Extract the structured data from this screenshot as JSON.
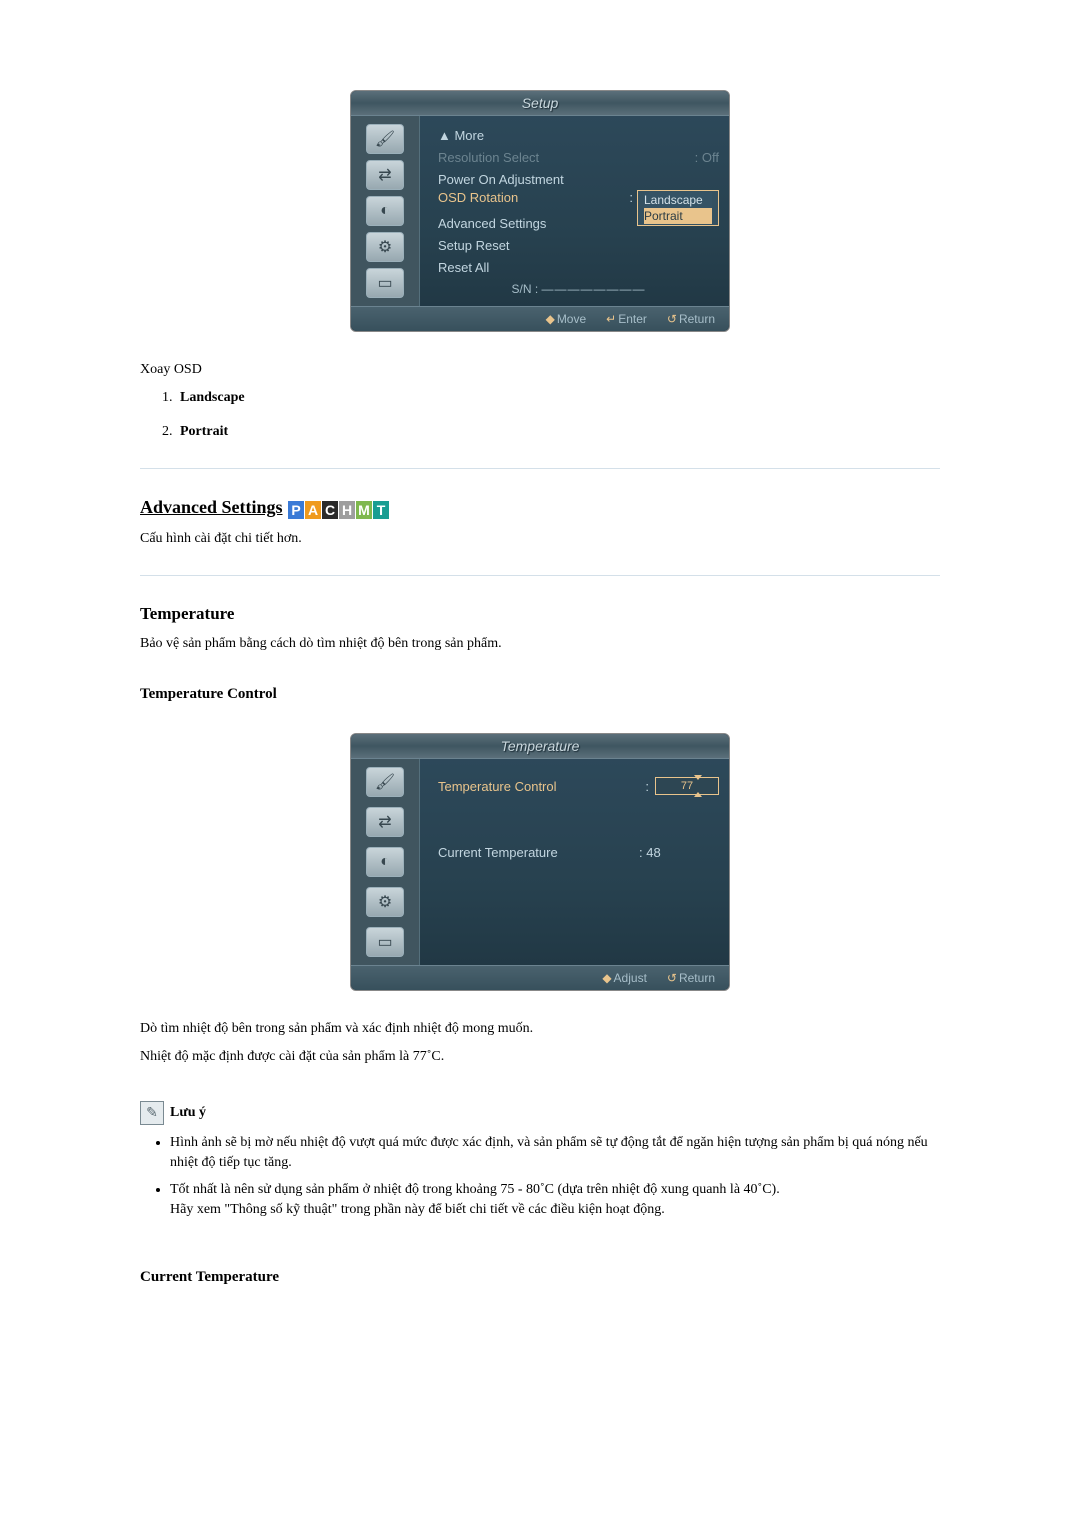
{
  "osd_setup": {
    "title": "Setup",
    "menu": {
      "more": "▲ More",
      "resolution": "Resolution Select",
      "resolution_val": ": Off",
      "power_on": "Power On Adjustment",
      "osd_rotation": "OSD Rotation",
      "osd_rotation_sep": ":",
      "dropdown_opt1": "Landscape",
      "dropdown_opt2": "Portrait",
      "advanced": "Advanced Settings",
      "setup_reset": "Setup Reset",
      "reset_all": "Reset All",
      "sn": "S/N : "
    },
    "footer": {
      "move_icon": "◆",
      "move": "Move",
      "enter_icon": "↵",
      "enter": "Enter",
      "return_icon": "↺",
      "return": "Return"
    }
  },
  "xoay_label": "Xoay OSD",
  "enum": {
    "landscape": "Landscape",
    "portrait": "Portrait"
  },
  "adv_settings": {
    "title": "Advanced Settings",
    "badges": {
      "p": "P",
      "a": "A",
      "c": "C",
      "h": "H",
      "m": "M",
      "t": "T"
    },
    "desc": "Cấu hình cài đặt chi tiết hơn."
  },
  "temperature": {
    "title": "Temperature",
    "desc": "Bảo vệ sản phẩm bằng cách dò tìm nhiệt độ bên trong sản phẩm.",
    "control_title": "Temperature Control"
  },
  "osd_temp": {
    "title": "Temperature",
    "control_label": "Temperature Control",
    "control_sep": ":",
    "control_val": "77",
    "current_label": "Current Temperature",
    "current_val": ": 48",
    "footer": {
      "adjust_icon": "◆",
      "adjust": "Adjust",
      "return_icon": "↺",
      "return": "Return"
    }
  },
  "after_temp": {
    "line1": "Dò tìm nhiệt độ bên trong sản phẩm và xác định nhiệt độ mong muốn.",
    "line2": "Nhiệt độ mặc định được cài đặt của sản phẩm là 77˚C."
  },
  "note": {
    "title": "Lưu ý",
    "b1": "Hình ảnh sẽ bị mờ nếu nhiệt độ vượt quá mức được xác định, và sản phẩm sẽ tự động tắt để ngăn hiện tượng sản phẩm bị quá nóng nếu nhiệt độ tiếp tục tăng.",
    "b2": "Tốt nhất là nên sử dụng sản phẩm ở nhiệt độ trong khoảng 75 - 80˚C (dựa trên nhiệt độ xung quanh là 40˚C).",
    "b3": "Hãy xem \"Thông số kỹ thuật\" trong phần này để biết chi tiết về các điều kiện hoạt động."
  },
  "current_temp_title": "Current Temperature"
}
